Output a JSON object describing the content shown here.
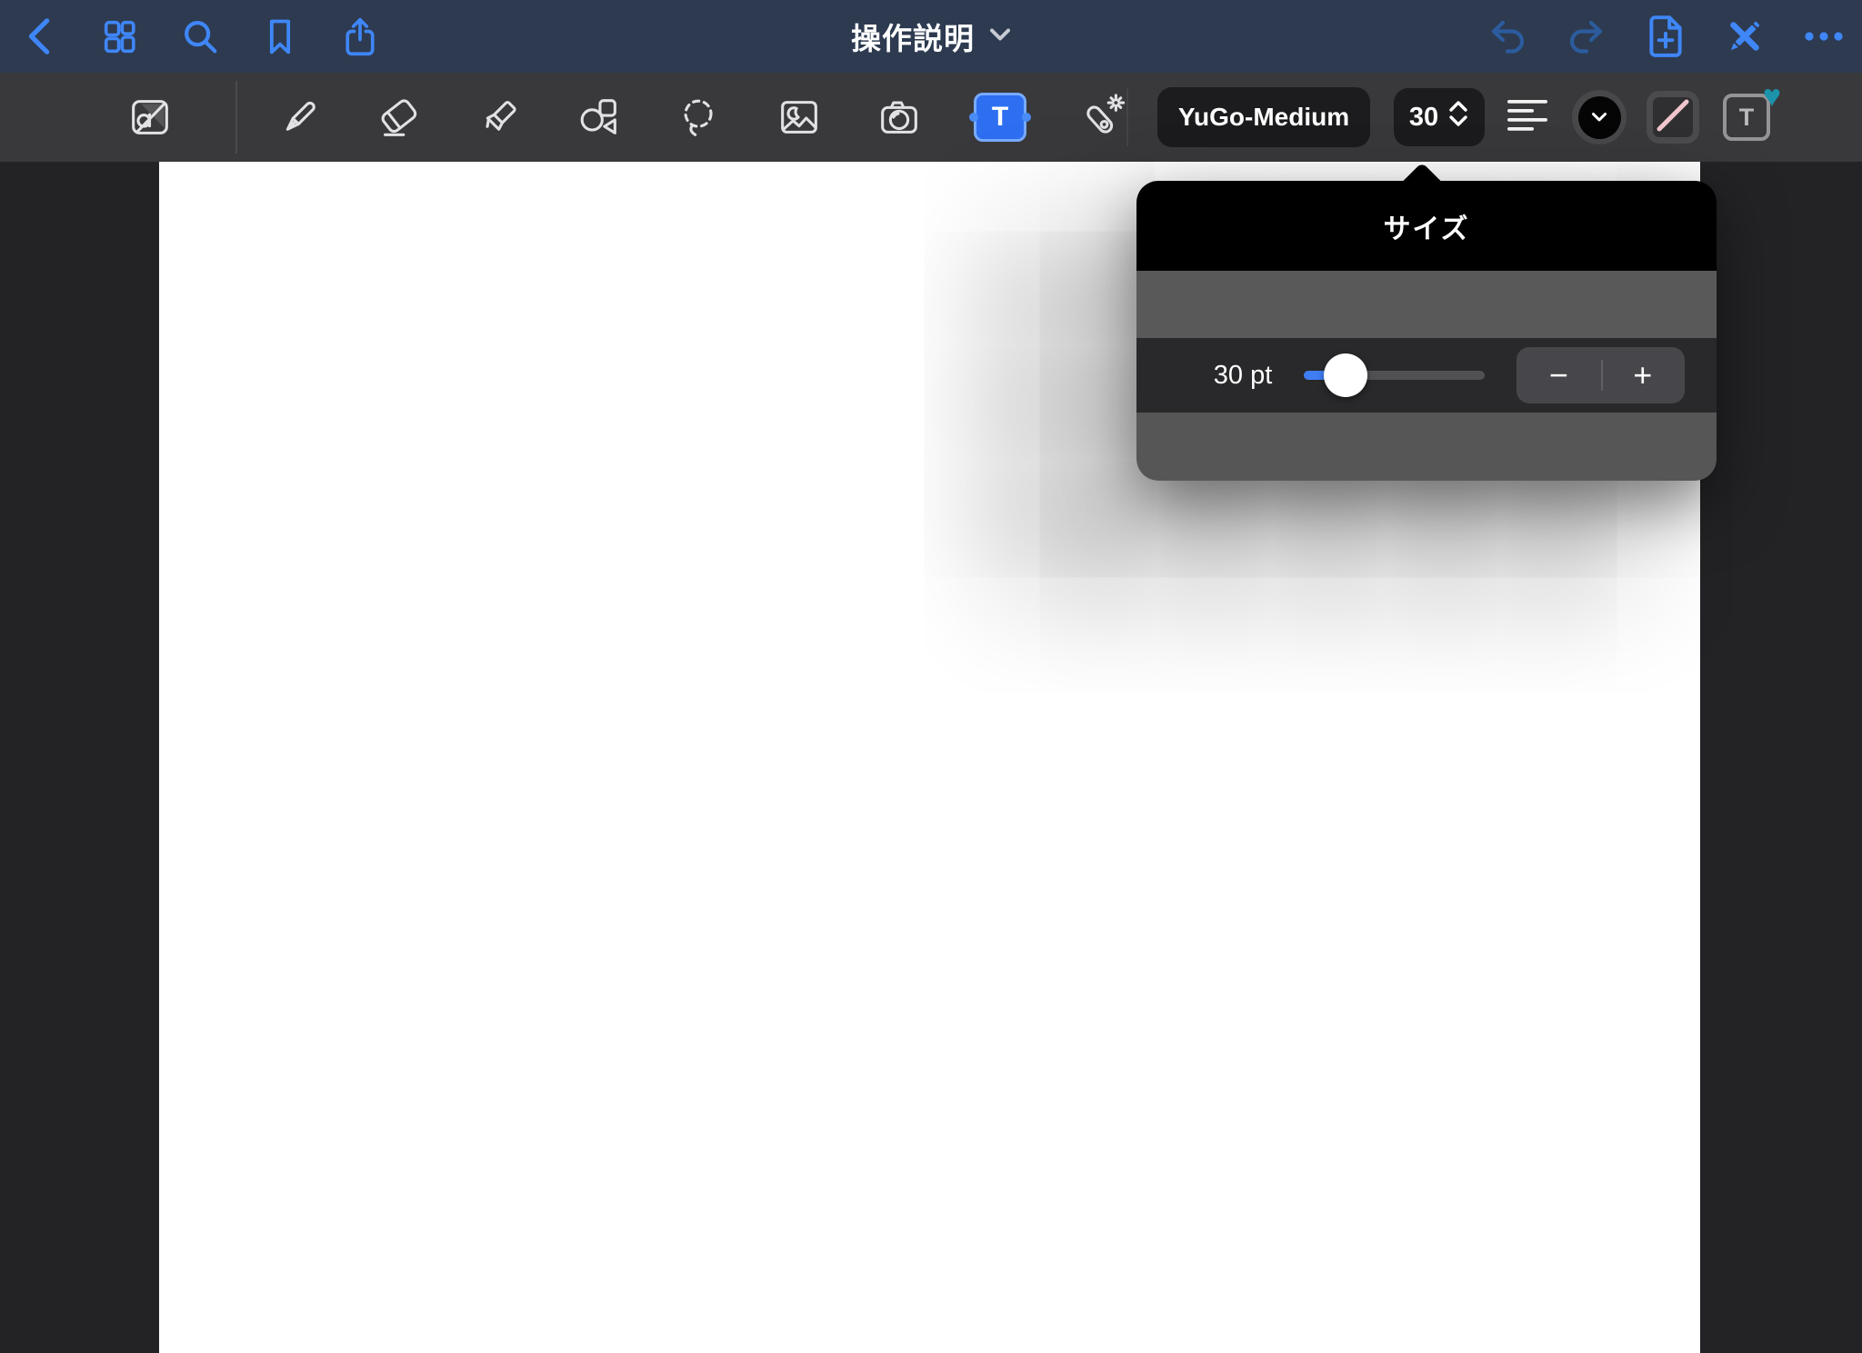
{
  "topbar": {
    "title": "操作説明",
    "left_icons": [
      {
        "name": "back-chevron",
        "enabled": true
      },
      {
        "name": "page-thumbnails-grid",
        "enabled": true
      },
      {
        "name": "search",
        "enabled": true
      },
      {
        "name": "bookmark",
        "enabled": true
      },
      {
        "name": "share",
        "enabled": true
      }
    ],
    "right_icons": [
      {
        "name": "undo",
        "enabled": false
      },
      {
        "name": "redo",
        "enabled": false
      },
      {
        "name": "add-page",
        "enabled": true
      },
      {
        "name": "stop-editing-pencil-x",
        "enabled": true
      },
      {
        "name": "more-ellipsis",
        "enabled": true
      }
    ]
  },
  "toolbar": {
    "tools": [
      "read-only-mode",
      "pen",
      "eraser",
      "highlighter",
      "shapes",
      "lasso",
      "image",
      "camera",
      "text",
      "laser-pointer"
    ],
    "selected_tool": "text",
    "text_tool_glyph": "T",
    "font_button_label": "YuGo-Medium",
    "size_value": "30",
    "right_controls": [
      "font",
      "size",
      "text-align-left",
      "text-color-black",
      "text-box-stroke",
      "text-style-favorite"
    ],
    "style_button_glyph": "T",
    "style_heart_icon": "♥"
  },
  "popover": {
    "title": "サイズ",
    "size_label": "30 pt",
    "slider": {
      "value_pt": 30,
      "fraction": 0.23
    },
    "stepper": {
      "minus": "−",
      "plus": "+"
    }
  },
  "canvas": {
    "page_color": "#ffffff"
  },
  "colors": {
    "topbar_bg": "#2d3a50",
    "accent_blue": "#3f86f7",
    "disabled_blue": "#2c5c9e",
    "toolbar_bg": "#39393b",
    "dark_button_bg": "#1c1c1e",
    "selected_tool_blue": "#2e6ff2",
    "popover_header_bg": "#000000",
    "popover_band_gray": "#595959",
    "popover_row_dark": "#29292b",
    "popover_bottom_gray": "#565656",
    "slider_blue": "#3f7df5",
    "teal_heart": "#1b93ab",
    "pink_stroke": "#efc6cd",
    "margin_bg": "#232326"
  }
}
